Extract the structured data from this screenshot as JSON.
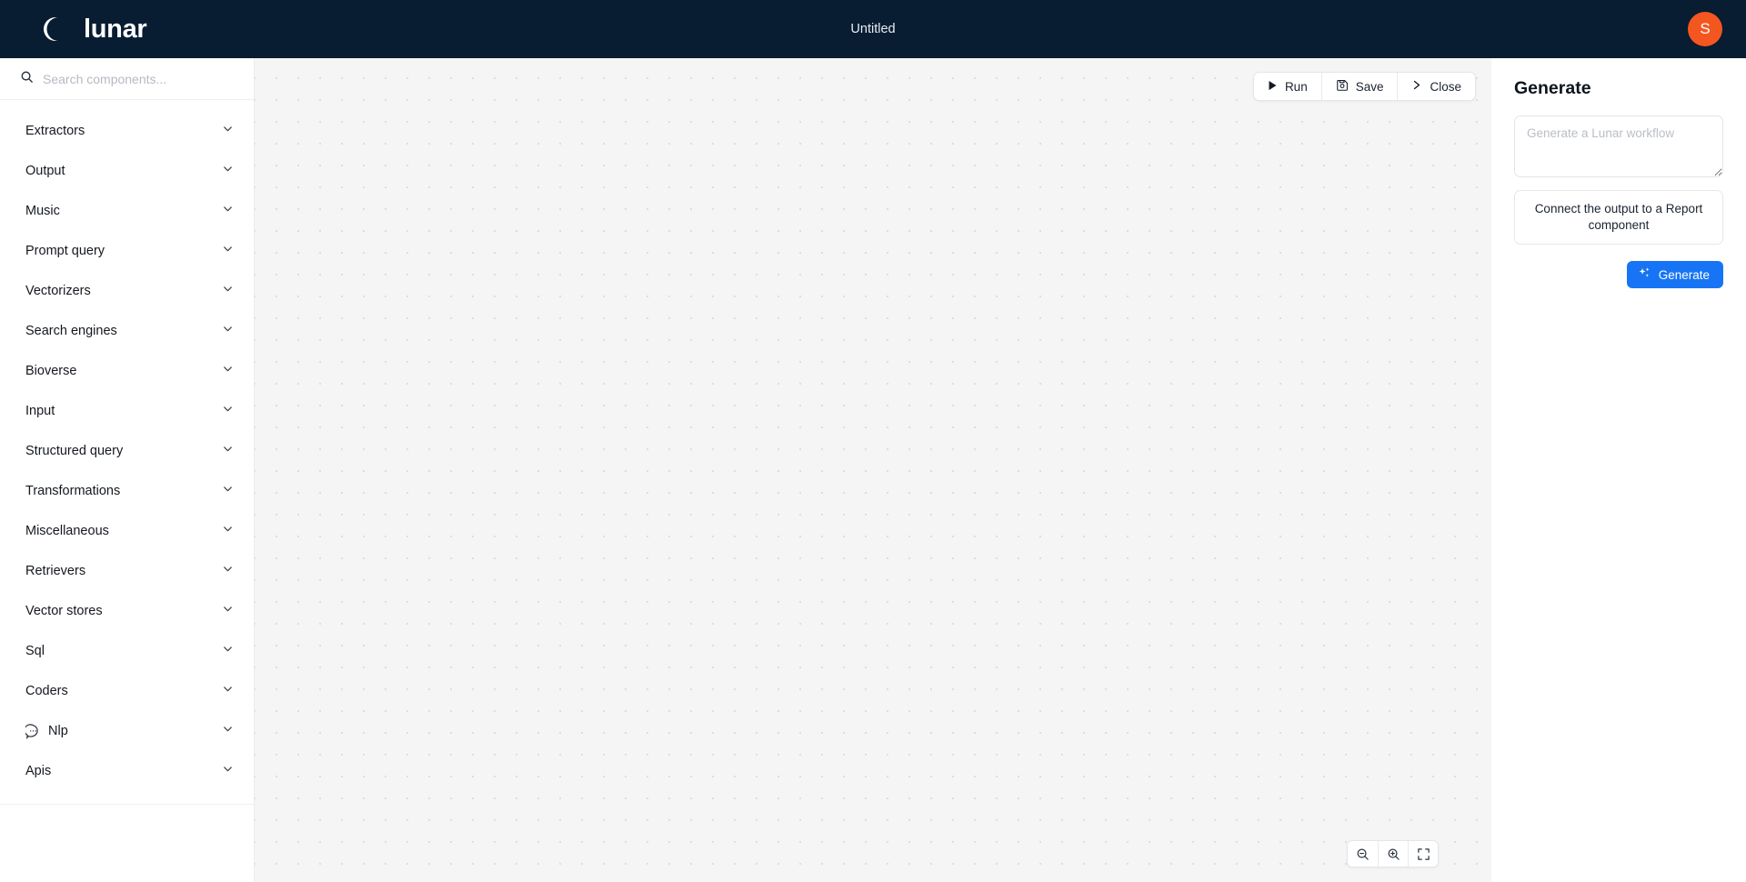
{
  "header": {
    "brand_name": "lunar",
    "brand_icon": "crescent-moon-icon",
    "title": "Untitled",
    "avatar_initial": "S",
    "avatar_color": "#f4561f",
    "background_color": "#081c32"
  },
  "sidebar": {
    "search": {
      "placeholder": "Search components...",
      "value": "",
      "icon": "search-icon"
    },
    "categories": [
      {
        "label": "Extractors",
        "icon": null,
        "chevron": "chevron-down-icon"
      },
      {
        "label": "Output",
        "icon": null,
        "chevron": "chevron-down-icon"
      },
      {
        "label": "Music",
        "icon": null,
        "chevron": "chevron-down-icon"
      },
      {
        "label": "Prompt query",
        "icon": null,
        "chevron": "chevron-down-icon"
      },
      {
        "label": "Vectorizers",
        "icon": null,
        "chevron": "chevron-down-icon"
      },
      {
        "label": "Search engines",
        "icon": null,
        "chevron": "chevron-down-icon"
      },
      {
        "label": "Bioverse",
        "icon": null,
        "chevron": "chevron-down-icon"
      },
      {
        "label": "Input",
        "icon": null,
        "chevron": "chevron-down-icon"
      },
      {
        "label": "Structured query",
        "icon": null,
        "chevron": "chevron-down-icon"
      },
      {
        "label": "Transformations",
        "icon": null,
        "chevron": "chevron-down-icon"
      },
      {
        "label": "Miscellaneous",
        "icon": null,
        "chevron": "chevron-down-icon"
      },
      {
        "label": "Retrievers",
        "icon": null,
        "chevron": "chevron-down-icon"
      },
      {
        "label": "Vector stores",
        "icon": null,
        "chevron": "chevron-down-icon"
      },
      {
        "label": "Sql",
        "icon": null,
        "chevron": "chevron-down-icon"
      },
      {
        "label": "Coders",
        "icon": null,
        "chevron": "chevron-down-icon"
      },
      {
        "label": "Nlp",
        "icon": "chat-bubble-dots-icon",
        "chevron": "chevron-down-icon"
      },
      {
        "label": "Apis",
        "icon": null,
        "chevron": "chevron-down-icon"
      }
    ]
  },
  "canvas": {
    "toolbar": [
      {
        "label": "Run",
        "icon": "play-icon"
      },
      {
        "label": "Save",
        "icon": "floppy-disk-icon"
      },
      {
        "label": "Close",
        "icon": "chevron-right-icon"
      }
    ],
    "zoom_controls": [
      {
        "name": "zoom-out-icon"
      },
      {
        "name": "zoom-in-icon"
      },
      {
        "name": "fit-view-icon"
      }
    ],
    "background_color": "#f5f5f5",
    "dot_color": "#dedede"
  },
  "generate_panel": {
    "title": "Generate",
    "prompt": {
      "placeholder": "Generate a Lunar workflow",
      "value": ""
    },
    "suggestion": "Connect the output to a Report component",
    "generate_button": {
      "label": "Generate",
      "icon": "sparkles-icon",
      "color": "#1775f5"
    }
  }
}
